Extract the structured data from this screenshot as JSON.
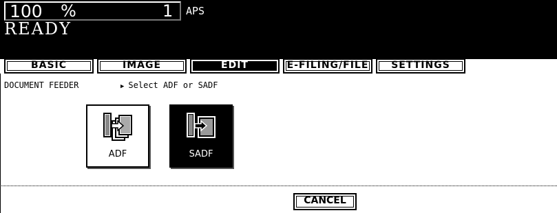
{
  "header": {
    "zoom_value": "100",
    "zoom_unit": "%",
    "copies": "1",
    "paper_mode": "APS",
    "status": "READY"
  },
  "tabs": [
    {
      "label": "BASIC",
      "active": false
    },
    {
      "label": "IMAGE",
      "active": false
    },
    {
      "label": "EDIT",
      "active": true
    },
    {
      "label": "E-FILING/FILE",
      "active": false
    },
    {
      "label": "SETTINGS",
      "active": false
    }
  ],
  "breadcrumb": "DOCUMENT FEEDER",
  "instruction": "Select ADF or SADF",
  "modes": [
    {
      "label": "ADF",
      "icon": "adf-feeder-icon",
      "selected": false
    },
    {
      "label": "SADF",
      "icon": "sadf-feeder-icon",
      "selected": true
    }
  ],
  "footer": {
    "cancel_label": "CANCEL"
  }
}
